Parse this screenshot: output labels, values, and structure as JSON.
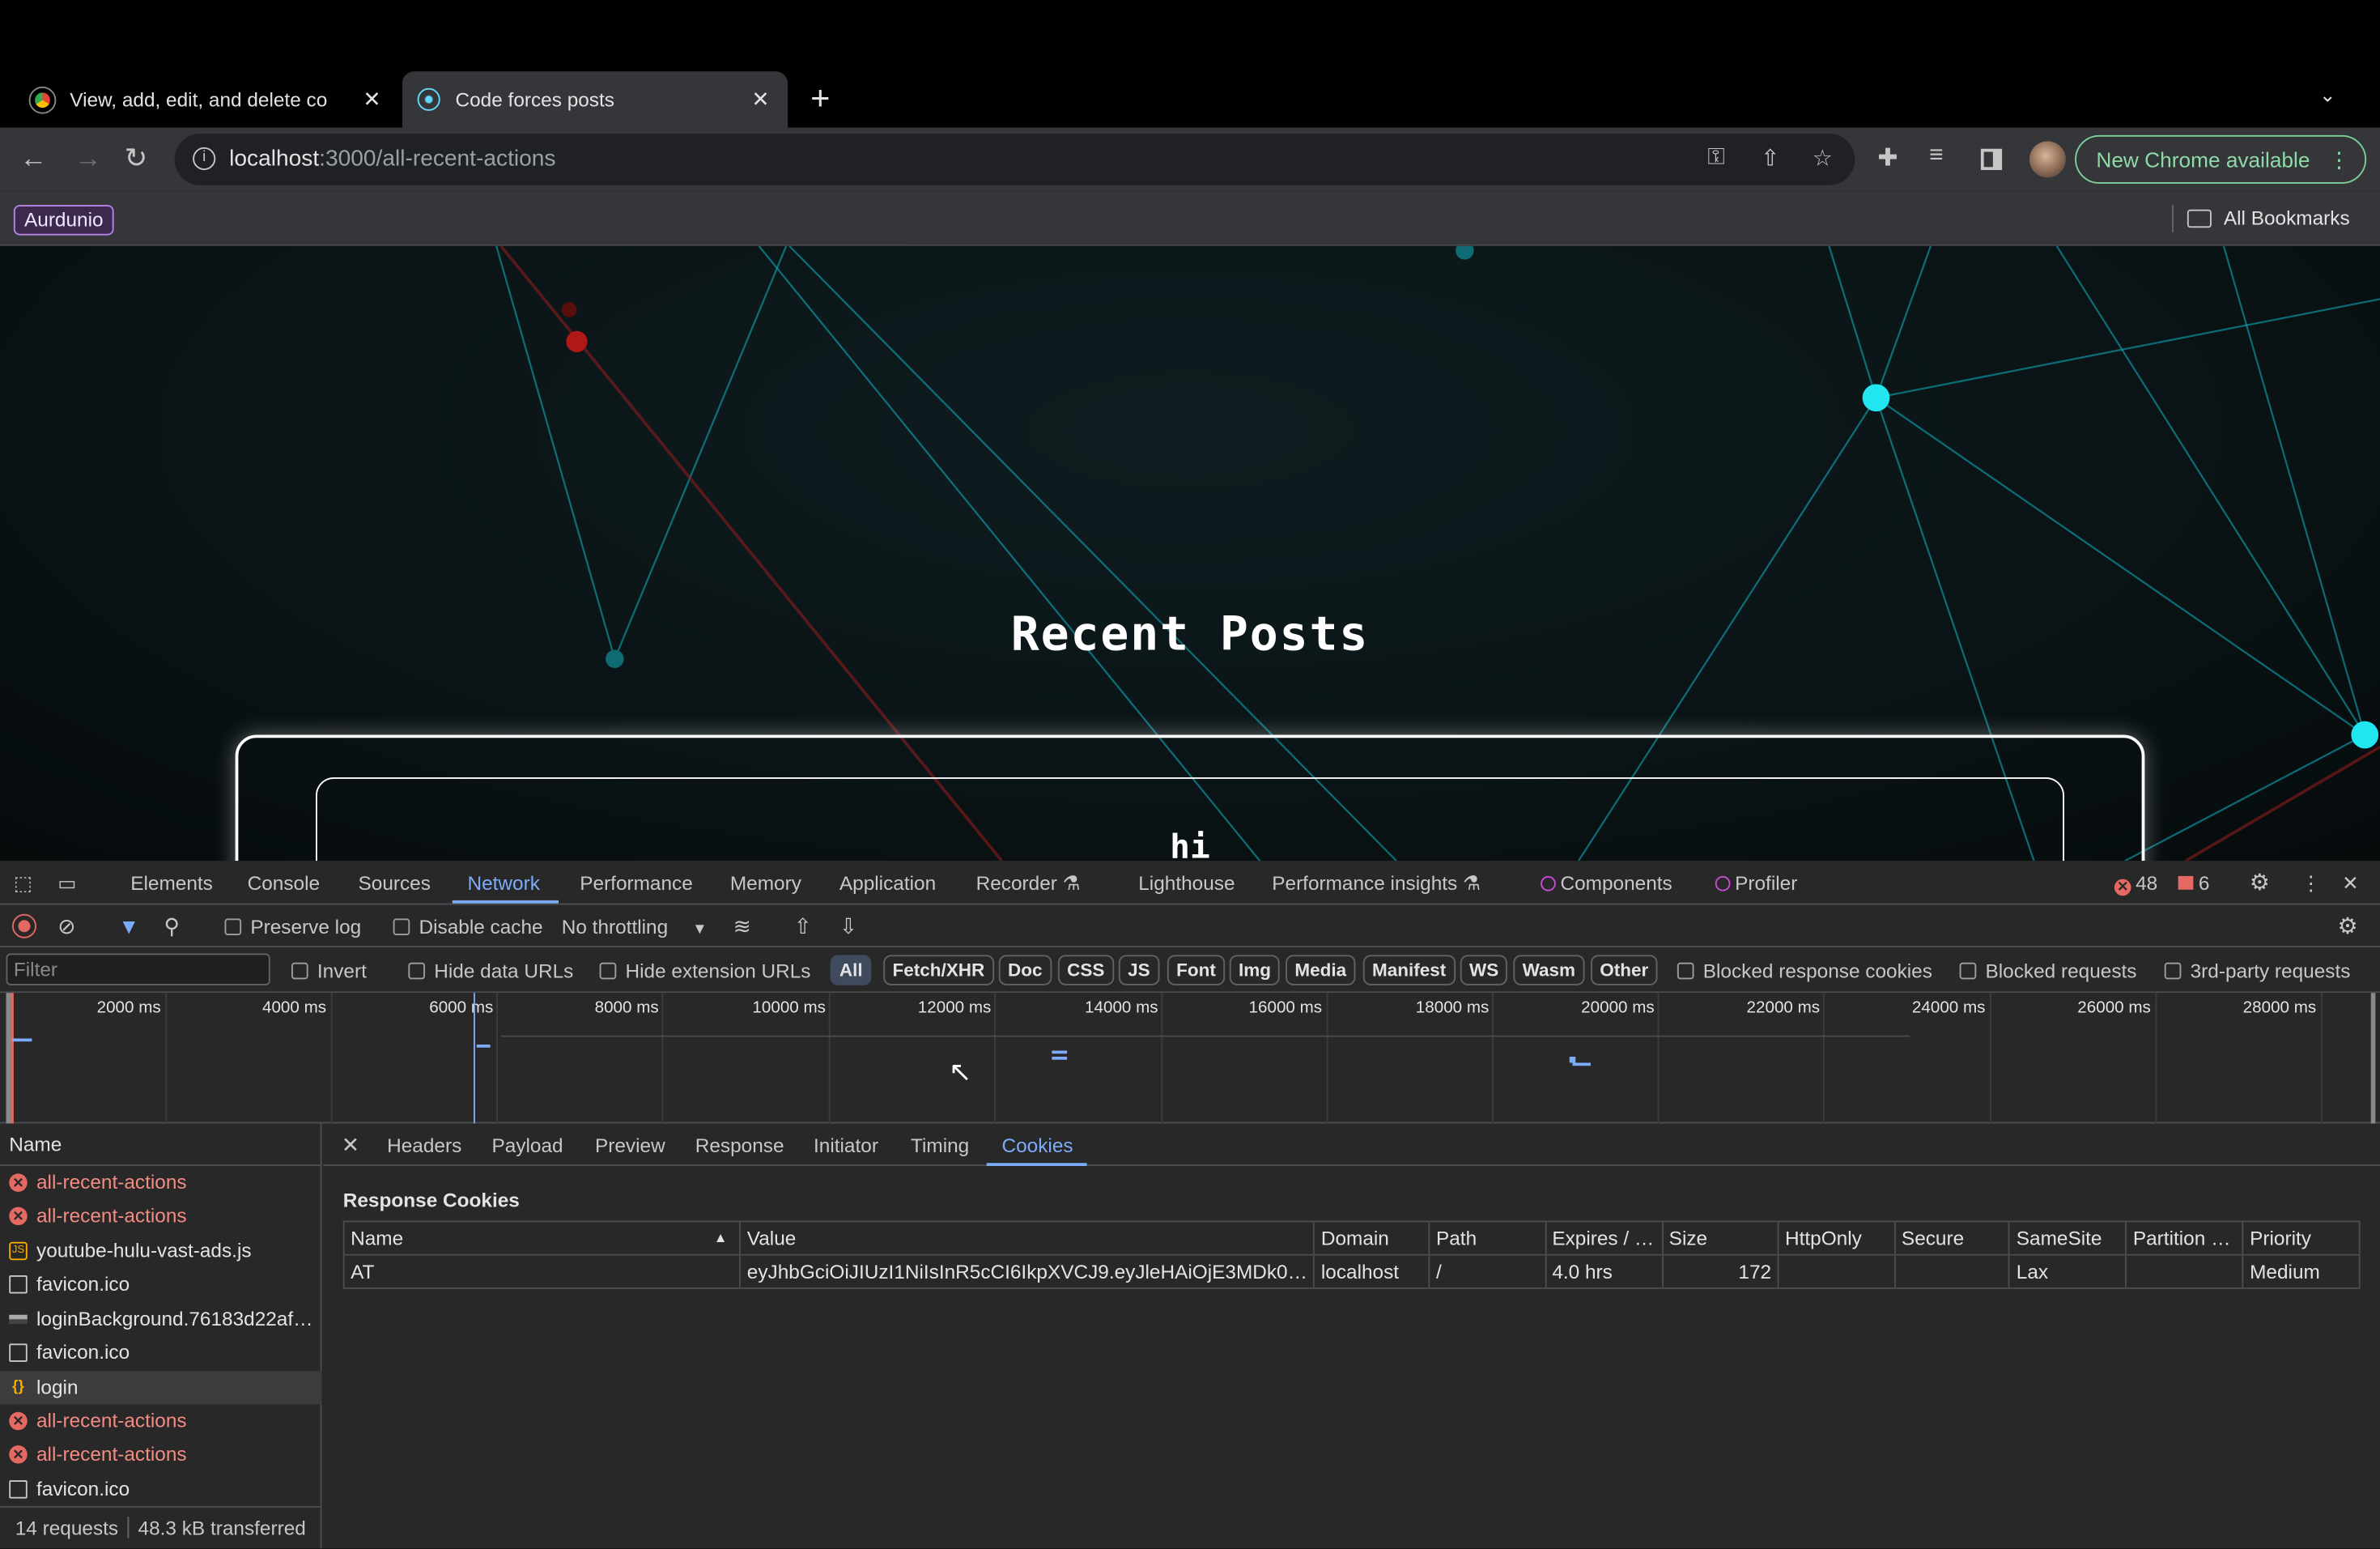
{
  "browser": {
    "tabs": [
      {
        "title": "View, add, edit, and delete co",
        "active": false
      },
      {
        "title": "Code forces posts",
        "active": true
      }
    ],
    "url_host": "localhost",
    "url_path": ":3000/all-recent-actions",
    "update_label": "New Chrome available",
    "bookmark": "Aurdunio",
    "all_bookmarks": "All Bookmarks"
  },
  "page": {
    "heading": "Recent Posts",
    "post_title": "hi"
  },
  "devtools": {
    "tabs": [
      "Elements",
      "Console",
      "Sources",
      "Network",
      "Performance",
      "Memory",
      "Application",
      "Recorder",
      "Lighthouse",
      "Performance insights",
      "Components",
      "Profiler"
    ],
    "active_tab": "Network",
    "errors": "48",
    "issues": "6",
    "toolbar": {
      "preserve_log": "Preserve log",
      "disable_cache": "Disable cache",
      "throttling": "No throttling"
    },
    "filter_placeholder": "Filter",
    "filter_opts": {
      "invert": "Invert",
      "hide_data": "Hide data URLs",
      "hide_ext": "Hide extension URLs",
      "blocked_cookies": "Blocked response cookies",
      "blocked_requests": "Blocked requests",
      "third_party": "3rd-party requests"
    },
    "type_chips": [
      "All",
      "Fetch/XHR",
      "Doc",
      "CSS",
      "JS",
      "Font",
      "Img",
      "Media",
      "Manifest",
      "WS",
      "Wasm",
      "Other"
    ],
    "timeline_ticks": [
      "2000 ms",
      "4000 ms",
      "6000 ms",
      "8000 ms",
      "10000 ms",
      "12000 ms",
      "14000 ms",
      "16000 ms",
      "18000 ms",
      "20000 ms",
      "22000 ms",
      "24000 ms",
      "26000 ms",
      "28000 ms"
    ],
    "name_header": "Name",
    "requests": [
      {
        "name": "all-recent-actions",
        "icon": "error",
        "selected": false
      },
      {
        "name": "all-recent-actions",
        "icon": "error",
        "selected": false
      },
      {
        "name": "youtube-hulu-vast-ads.js",
        "icon": "script",
        "selected": false
      },
      {
        "name": "favicon.ico",
        "icon": "document",
        "selected": false
      },
      {
        "name": "loginBackground.76183d22af…",
        "icon": "image",
        "selected": false
      },
      {
        "name": "favicon.ico",
        "icon": "document",
        "selected": false
      },
      {
        "name": "login",
        "icon": "fetch",
        "selected": true
      },
      {
        "name": "all-recent-actions",
        "icon": "error",
        "selected": false
      },
      {
        "name": "all-recent-actions",
        "icon": "error",
        "selected": false
      },
      {
        "name": "favicon.ico",
        "icon": "document",
        "selected": false
      }
    ],
    "summary": {
      "requests": "14 requests",
      "transferred": "48.3 kB transferred"
    },
    "detail_tabs": [
      "Headers",
      "Payload",
      "Preview",
      "Response",
      "Initiator",
      "Timing",
      "Cookies"
    ],
    "active_detail_tab": "Cookies",
    "response_cookies_label": "Response Cookies",
    "cookie_columns": [
      "Name",
      "Value",
      "Domain",
      "Path",
      "Expires / …",
      "Size",
      "HttpOnly",
      "Secure",
      "SameSite",
      "Partition …",
      "Priority"
    ],
    "cookies": [
      [
        "AT",
        "eyJhbGciOiJIUzI1NiIsInR5cCI6IkpXVCJ9.eyJleHAiOjE3MDk0…",
        "localhost",
        "/",
        "4.0 hrs",
        "172",
        "",
        "",
        "Lax",
        "",
        "Medium"
      ]
    ]
  }
}
